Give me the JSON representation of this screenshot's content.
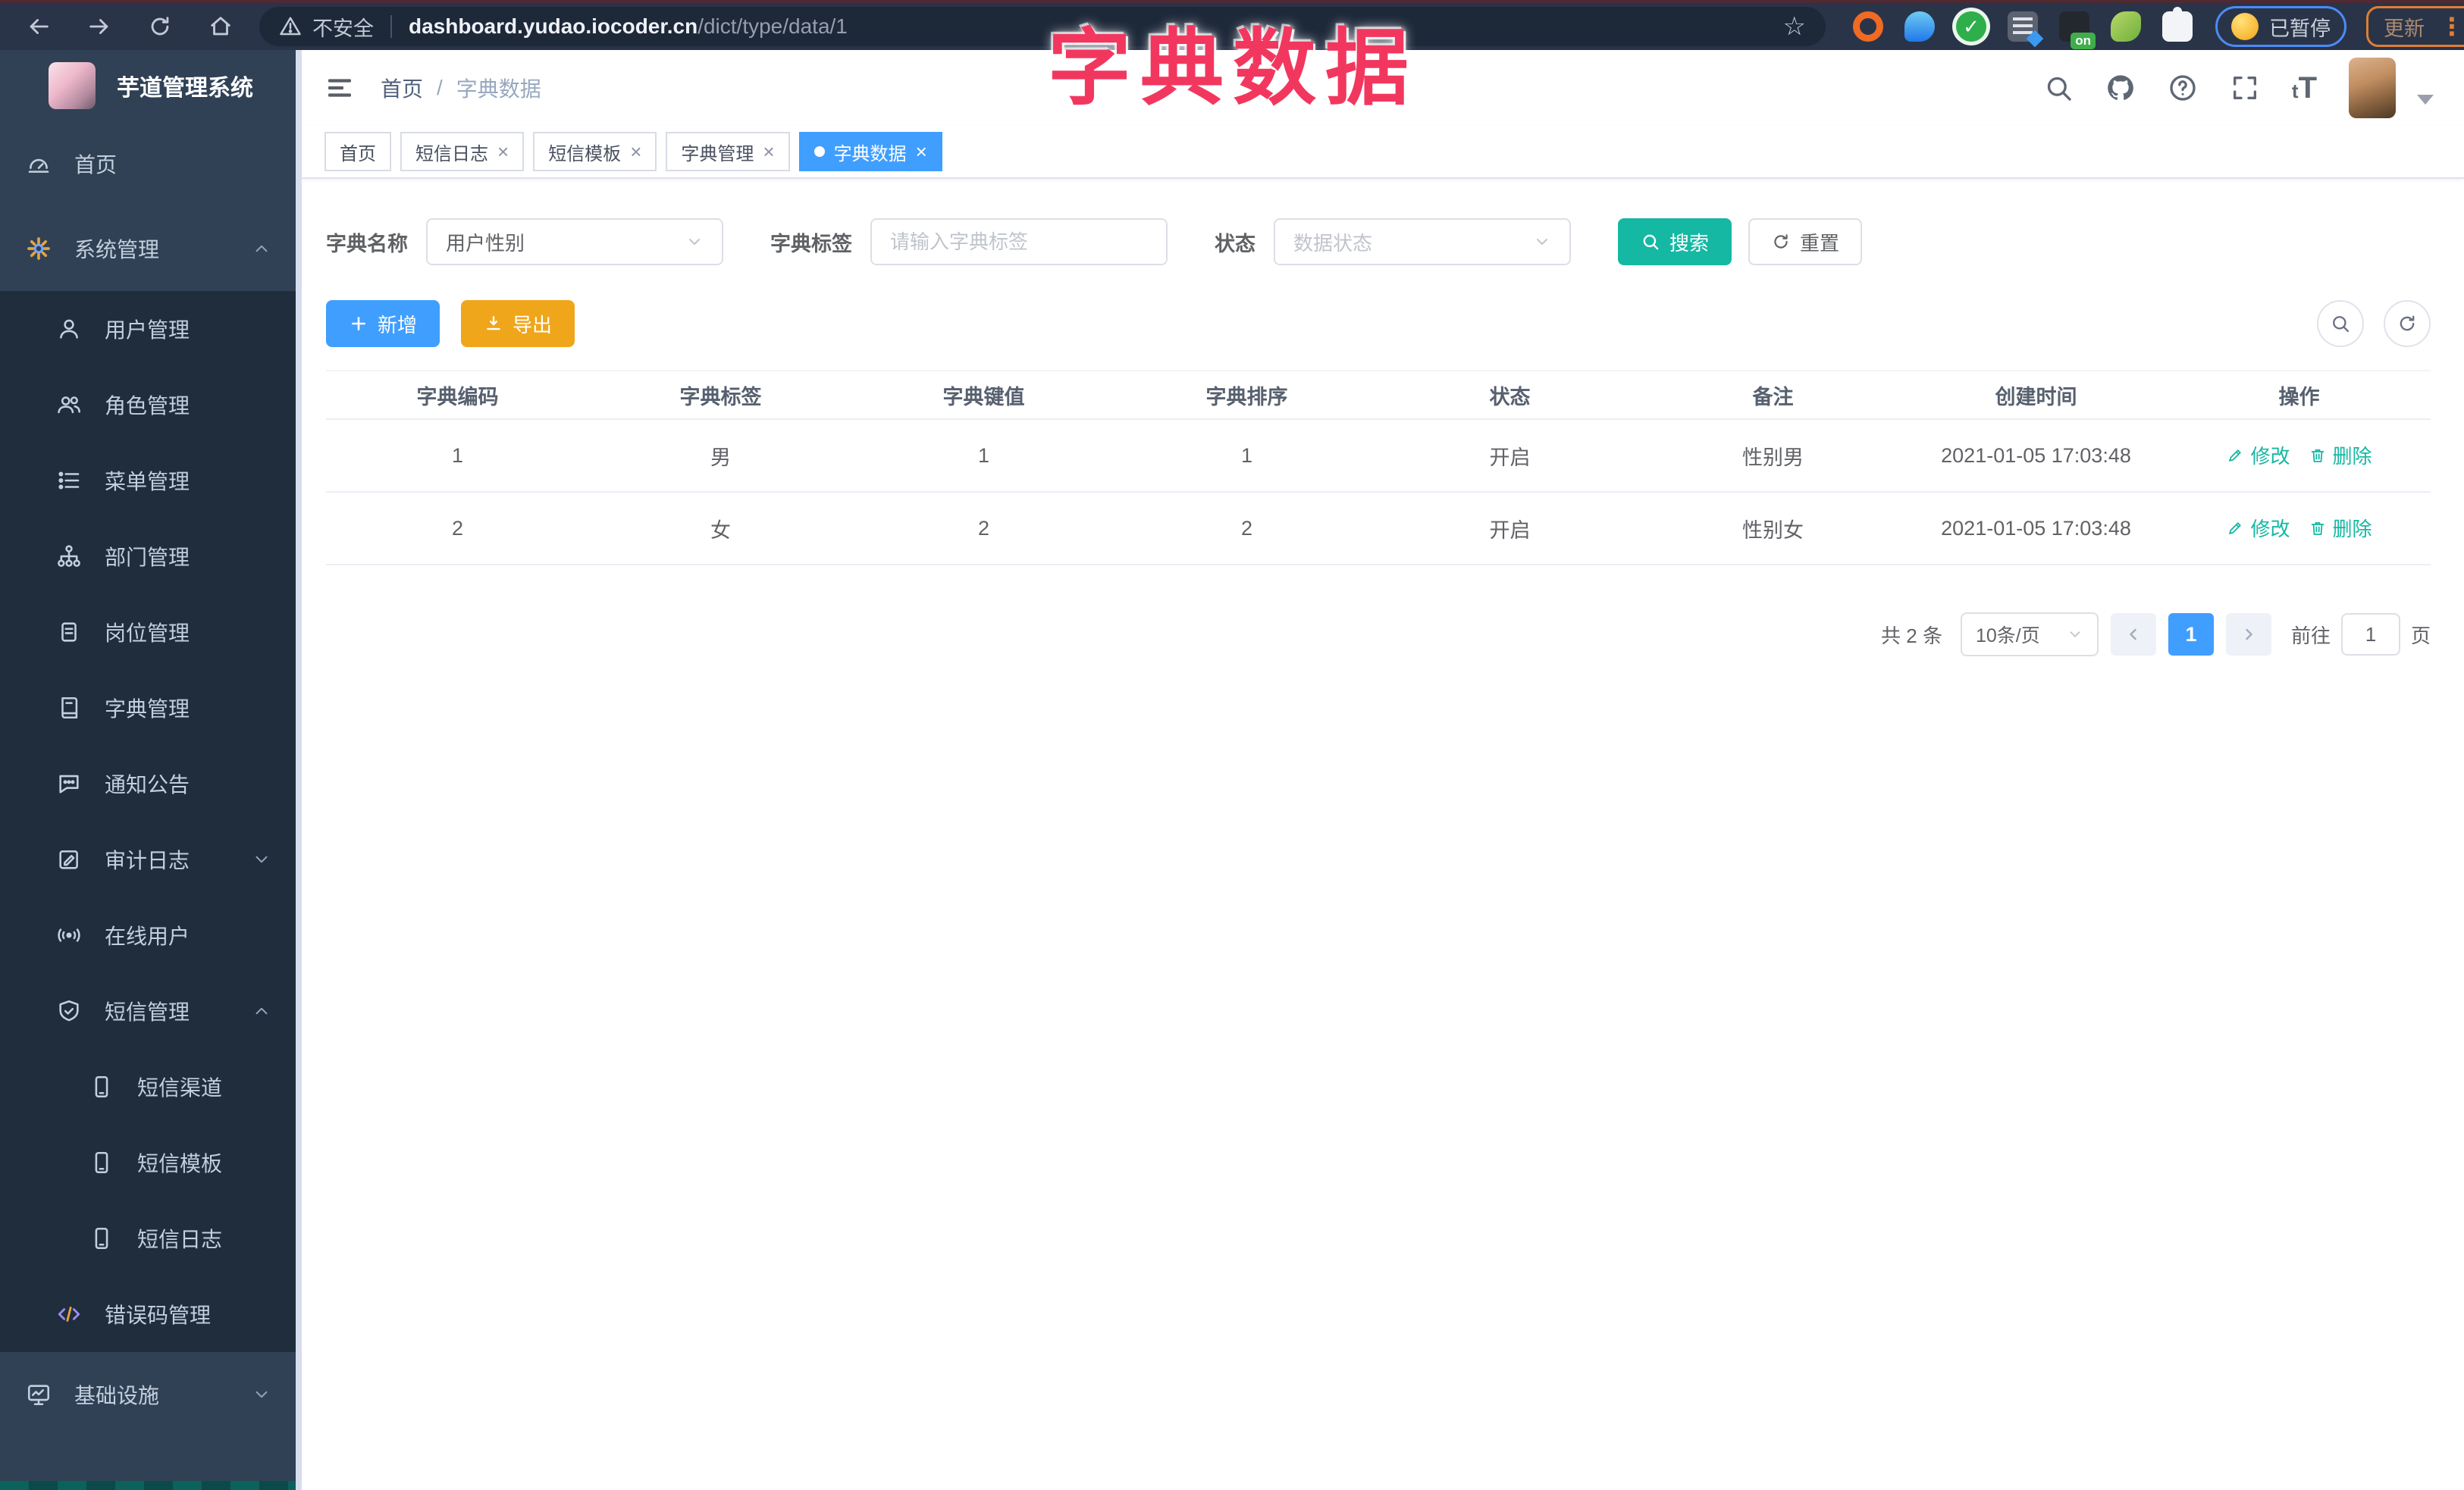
{
  "annotation": {
    "text": "字典数据"
  },
  "browser": {
    "security_label": "不安全",
    "url_host": "dashboard.yudao.iocoder.cn",
    "url_path": "/dict/type/data/1",
    "paused_label": "已暂停",
    "update_label": "更新",
    "extension_badge": "on"
  },
  "sidebar": {
    "logo_title": "芋道管理系统",
    "items": [
      {
        "key": "home",
        "label": "首页",
        "icon": "dashboard-icon",
        "level": 0
      },
      {
        "key": "system",
        "label": "系统管理",
        "icon": "gear-icon",
        "level": 0,
        "chevron": "up"
      },
      {
        "key": "user",
        "label": "用户管理",
        "icon": "user-icon",
        "level": 1
      },
      {
        "key": "role",
        "label": "角色管理",
        "icon": "users-icon",
        "level": 1
      },
      {
        "key": "menu",
        "label": "菜单管理",
        "icon": "menu-list-icon",
        "level": 1
      },
      {
        "key": "dept",
        "label": "部门管理",
        "icon": "tree-icon",
        "level": 1
      },
      {
        "key": "post",
        "label": "岗位管理",
        "icon": "badge-icon",
        "level": 1
      },
      {
        "key": "dict",
        "label": "字典管理",
        "icon": "book-icon",
        "level": 1
      },
      {
        "key": "notice",
        "label": "通知公告",
        "icon": "chat-icon",
        "level": 1
      },
      {
        "key": "audit-log",
        "label": "审计日志",
        "icon": "edit-log-icon",
        "level": 1,
        "chevron": "down"
      },
      {
        "key": "online-user",
        "label": "在线用户",
        "icon": "online-icon",
        "level": 1
      },
      {
        "key": "sms",
        "label": "短信管理",
        "icon": "shield-check-icon",
        "level": 1,
        "chevron": "up"
      },
      {
        "key": "sms-channel",
        "label": "短信渠道",
        "icon": "phone-icon",
        "level": 2
      },
      {
        "key": "sms-template",
        "label": "短信模板",
        "icon": "phone-icon",
        "level": 2
      },
      {
        "key": "sms-log",
        "label": "短信日志",
        "icon": "phone-icon",
        "level": 2
      },
      {
        "key": "error-code",
        "label": "错误码管理",
        "icon": "code-icon",
        "level": 1
      },
      {
        "key": "infra",
        "label": "基础设施",
        "icon": "monitor-icon",
        "level": 0,
        "chevron": "down"
      }
    ]
  },
  "navbar": {
    "breadcrumb_home": "首页",
    "breadcrumb_sep": "/",
    "breadcrumb_current": "字典数据",
    "font_size_glyph_small": "t",
    "font_size_glyph_big": "T"
  },
  "tags": {
    "items": [
      {
        "key": "home",
        "label": "首页",
        "closable": false,
        "active": false
      },
      {
        "key": "sms-log",
        "label": "短信日志",
        "closable": true,
        "active": false
      },
      {
        "key": "sms-template",
        "label": "短信模板",
        "closable": true,
        "active": false
      },
      {
        "key": "dict-type",
        "label": "字典管理",
        "closable": true,
        "active": false
      },
      {
        "key": "dict-data",
        "label": "字典数据",
        "closable": true,
        "active": true
      }
    ]
  },
  "search": {
    "name_label": "字典名称",
    "name_value": "用户性别",
    "tag_label": "字典标签",
    "tag_placeholder": "请输入字典标签",
    "status_label": "状态",
    "status_placeholder": "数据状态",
    "search_button": "搜索",
    "reset_button": "重置"
  },
  "toolbar": {
    "add_button": "新增",
    "export_button": "导出"
  },
  "table": {
    "columns": [
      "字典编码",
      "字典标签",
      "字典键值",
      "字典排序",
      "状态",
      "备注",
      "创建时间",
      "操作"
    ],
    "rows": [
      {
        "code": "1",
        "label": "男",
        "value": "1",
        "sort": "1",
        "status": "开启",
        "remark": "性别男",
        "created": "2021-01-05 17:03:48"
      },
      {
        "code": "2",
        "label": "女",
        "value": "2",
        "sort": "2",
        "status": "开启",
        "remark": "性别女",
        "created": "2021-01-05 17:03:48"
      }
    ],
    "edit_action": "修改",
    "delete_action": "删除"
  },
  "pagination": {
    "total": "共 2 条",
    "page_size": "10条/页",
    "current": "1",
    "goto": "前往",
    "goto_value": "1",
    "unit": "页"
  },
  "icons": {
    "browser": [
      "back-icon",
      "forward-icon",
      "reload-icon",
      "home-icon",
      "warning-icon",
      "bookmark-star-icon",
      "kebab-menu-icon"
    ],
    "navbar": [
      "hamburger-icon",
      "search-icon",
      "github-icon",
      "help-icon",
      "fullscreen-icon",
      "font-size-icon",
      "caret-down-icon"
    ],
    "content": [
      "plus-icon",
      "download-icon",
      "search-icon",
      "refresh-icon",
      "edit-icon",
      "delete-icon",
      "chevron-down-icon",
      "chevron-left-icon",
      "chevron-right-icon"
    ]
  },
  "colors": {
    "primary": "#409eff",
    "teal_accent": "#15b8a3",
    "warning": "#f0a61a",
    "sidebar_bg": "#304156",
    "submenu_bg": "#1f2d3d",
    "annotation": "#f2375f"
  }
}
